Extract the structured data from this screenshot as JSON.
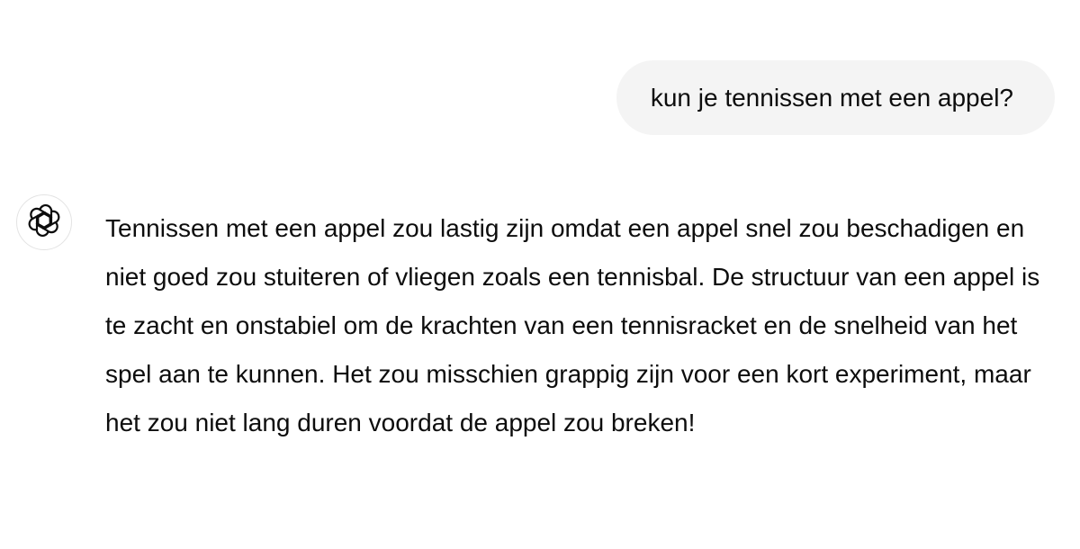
{
  "conversation": {
    "user_message": "kun je tennissen met een appel?",
    "assistant_message": "Tennissen met een appel zou lastig zijn omdat een appel snel zou beschadigen en niet goed zou stuiteren of vliegen zoals een tennisbal. De structuur van een appel is te zacht en onstabiel om de krachten van een tennisracket en de snelheid van het spel aan te kunnen. Het zou misschien grappig zijn voor een kort experiment, maar het zou niet lang duren voordat de appel zou breken!",
    "assistant_avatar_icon": "openai-logo-icon"
  },
  "colors": {
    "user_bubble": "#f4f4f4",
    "text": "#0d0d0d",
    "avatar_border": "#e3e3e3"
  }
}
